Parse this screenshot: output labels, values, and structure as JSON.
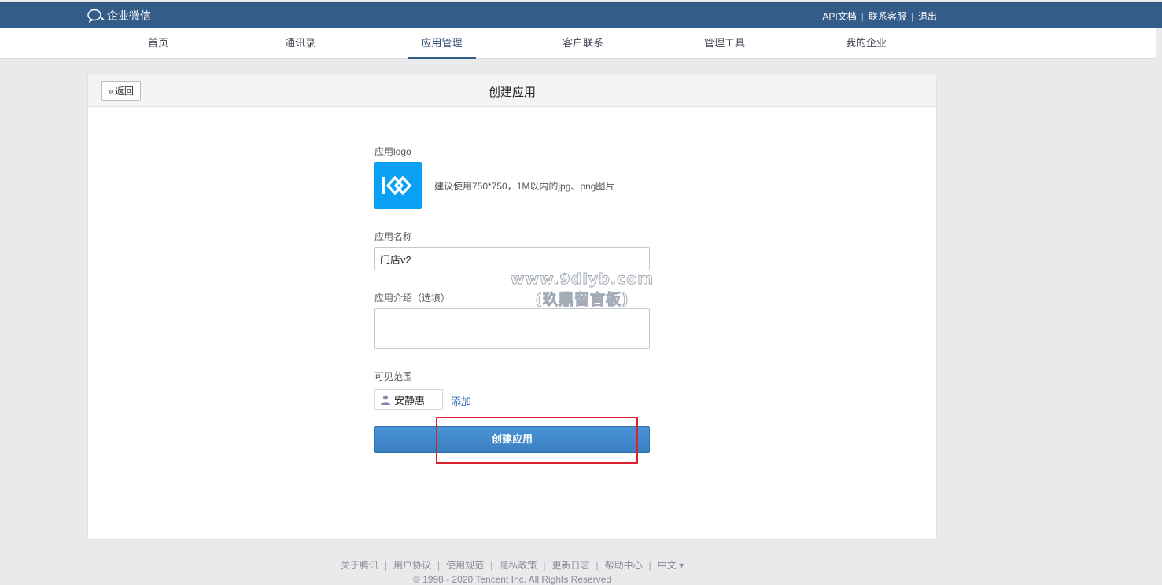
{
  "topbar": {
    "brand": "企业微信",
    "links": {
      "api": "API文档",
      "support": "联系客服",
      "logout": "退出"
    },
    "separator": "|"
  },
  "nav": {
    "items": [
      {
        "label": "首页",
        "active": false
      },
      {
        "label": "通讯录",
        "active": false
      },
      {
        "label": "应用管理",
        "active": true
      },
      {
        "label": "客户联系",
        "active": false
      },
      {
        "label": "管理工具",
        "active": false
      },
      {
        "label": "我的企业",
        "active": false
      }
    ]
  },
  "panel": {
    "back_label": "返回",
    "title": "创建应用"
  },
  "form": {
    "logo_label": "应用logo",
    "logo_hint": "建议使用750*750，1M以内的jpg、png图片",
    "name_label": "应用名称",
    "name_value": "门店v2",
    "intro_label": "应用介绍（选填）",
    "intro_value": "",
    "visibility_label": "可见范围",
    "visible_member": "安静惠",
    "add_label": "添加",
    "submit_label": "创建应用"
  },
  "watermark": {
    "line1": "www.9dlyb.com",
    "line2": "(玖鼎留言板)"
  },
  "footer": {
    "links": [
      "关于腾讯",
      "用户协议",
      "使用规范",
      "隐私政策",
      "更新日志",
      "帮助中心",
      "中文 ▾"
    ],
    "separator": "|",
    "copyright": "© 1998 - 2020 Tencent Inc. All Rights Reserved"
  },
  "colors": {
    "topbar": "#345c89",
    "primary_button": "#3a7fc2",
    "logo_bg": "#0aa1f5",
    "highlight": "#d9232e"
  }
}
